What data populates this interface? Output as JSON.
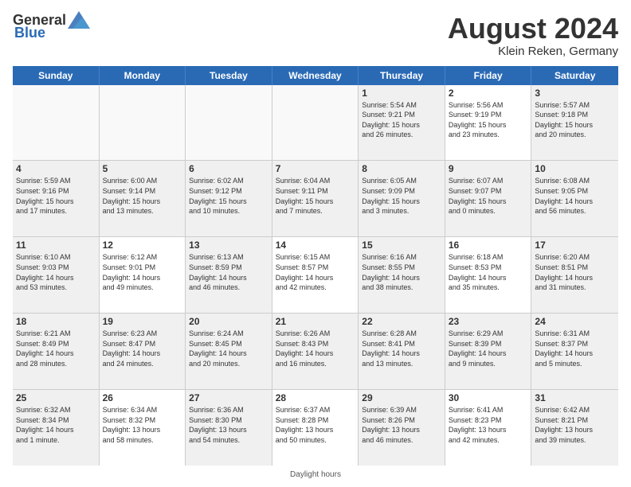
{
  "header": {
    "logo_general": "General",
    "logo_blue": "Blue",
    "month_title": "August 2024",
    "subtitle": "Klein Reken, Germany"
  },
  "days_of_week": [
    "Sunday",
    "Monday",
    "Tuesday",
    "Wednesday",
    "Thursday",
    "Friday",
    "Saturday"
  ],
  "footer_text": "Daylight hours",
  "weeks": [
    [
      {
        "day": "",
        "info": "",
        "shaded": true
      },
      {
        "day": "",
        "info": "",
        "shaded": true
      },
      {
        "day": "",
        "info": "",
        "shaded": true
      },
      {
        "day": "",
        "info": "",
        "shaded": true
      },
      {
        "day": "1",
        "info": "Sunrise: 5:54 AM\nSunset: 9:21 PM\nDaylight: 15 hours\nand 26 minutes.",
        "shaded": false
      },
      {
        "day": "2",
        "info": "Sunrise: 5:56 AM\nSunset: 9:19 PM\nDaylight: 15 hours\nand 23 minutes.",
        "shaded": false
      },
      {
        "day": "3",
        "info": "Sunrise: 5:57 AM\nSunset: 9:18 PM\nDaylight: 15 hours\nand 20 minutes.",
        "shaded": false
      }
    ],
    [
      {
        "day": "4",
        "info": "Sunrise: 5:59 AM\nSunset: 9:16 PM\nDaylight: 15 hours\nand 17 minutes.",
        "shaded": false
      },
      {
        "day": "5",
        "info": "Sunrise: 6:00 AM\nSunset: 9:14 PM\nDaylight: 15 hours\nand 13 minutes.",
        "shaded": false
      },
      {
        "day": "6",
        "info": "Sunrise: 6:02 AM\nSunset: 9:12 PM\nDaylight: 15 hours\nand 10 minutes.",
        "shaded": false
      },
      {
        "day": "7",
        "info": "Sunrise: 6:04 AM\nSunset: 9:11 PM\nDaylight: 15 hours\nand 7 minutes.",
        "shaded": false
      },
      {
        "day": "8",
        "info": "Sunrise: 6:05 AM\nSunset: 9:09 PM\nDaylight: 15 hours\nand 3 minutes.",
        "shaded": false
      },
      {
        "day": "9",
        "info": "Sunrise: 6:07 AM\nSunset: 9:07 PM\nDaylight: 15 hours\nand 0 minutes.",
        "shaded": false
      },
      {
        "day": "10",
        "info": "Sunrise: 6:08 AM\nSunset: 9:05 PM\nDaylight: 14 hours\nand 56 minutes.",
        "shaded": false
      }
    ],
    [
      {
        "day": "11",
        "info": "Sunrise: 6:10 AM\nSunset: 9:03 PM\nDaylight: 14 hours\nand 53 minutes.",
        "shaded": false
      },
      {
        "day": "12",
        "info": "Sunrise: 6:12 AM\nSunset: 9:01 PM\nDaylight: 14 hours\nand 49 minutes.",
        "shaded": false
      },
      {
        "day": "13",
        "info": "Sunrise: 6:13 AM\nSunset: 8:59 PM\nDaylight: 14 hours\nand 46 minutes.",
        "shaded": false
      },
      {
        "day": "14",
        "info": "Sunrise: 6:15 AM\nSunset: 8:57 PM\nDaylight: 14 hours\nand 42 minutes.",
        "shaded": false
      },
      {
        "day": "15",
        "info": "Sunrise: 6:16 AM\nSunset: 8:55 PM\nDaylight: 14 hours\nand 38 minutes.",
        "shaded": false
      },
      {
        "day": "16",
        "info": "Sunrise: 6:18 AM\nSunset: 8:53 PM\nDaylight: 14 hours\nand 35 minutes.",
        "shaded": false
      },
      {
        "day": "17",
        "info": "Sunrise: 6:20 AM\nSunset: 8:51 PM\nDaylight: 14 hours\nand 31 minutes.",
        "shaded": false
      }
    ],
    [
      {
        "day": "18",
        "info": "Sunrise: 6:21 AM\nSunset: 8:49 PM\nDaylight: 14 hours\nand 28 minutes.",
        "shaded": false
      },
      {
        "day": "19",
        "info": "Sunrise: 6:23 AM\nSunset: 8:47 PM\nDaylight: 14 hours\nand 24 minutes.",
        "shaded": false
      },
      {
        "day": "20",
        "info": "Sunrise: 6:24 AM\nSunset: 8:45 PM\nDaylight: 14 hours\nand 20 minutes.",
        "shaded": false
      },
      {
        "day": "21",
        "info": "Sunrise: 6:26 AM\nSunset: 8:43 PM\nDaylight: 14 hours\nand 16 minutes.",
        "shaded": false
      },
      {
        "day": "22",
        "info": "Sunrise: 6:28 AM\nSunset: 8:41 PM\nDaylight: 14 hours\nand 13 minutes.",
        "shaded": false
      },
      {
        "day": "23",
        "info": "Sunrise: 6:29 AM\nSunset: 8:39 PM\nDaylight: 14 hours\nand 9 minutes.",
        "shaded": false
      },
      {
        "day": "24",
        "info": "Sunrise: 6:31 AM\nSunset: 8:37 PM\nDaylight: 14 hours\nand 5 minutes.",
        "shaded": false
      }
    ],
    [
      {
        "day": "25",
        "info": "Sunrise: 6:32 AM\nSunset: 8:34 PM\nDaylight: 14 hours\nand 1 minute.",
        "shaded": false
      },
      {
        "day": "26",
        "info": "Sunrise: 6:34 AM\nSunset: 8:32 PM\nDaylight: 13 hours\nand 58 minutes.",
        "shaded": false
      },
      {
        "day": "27",
        "info": "Sunrise: 6:36 AM\nSunset: 8:30 PM\nDaylight: 13 hours\nand 54 minutes.",
        "shaded": false
      },
      {
        "day": "28",
        "info": "Sunrise: 6:37 AM\nSunset: 8:28 PM\nDaylight: 13 hours\nand 50 minutes.",
        "shaded": false
      },
      {
        "day": "29",
        "info": "Sunrise: 6:39 AM\nSunset: 8:26 PM\nDaylight: 13 hours\nand 46 minutes.",
        "shaded": false
      },
      {
        "day": "30",
        "info": "Sunrise: 6:41 AM\nSunset: 8:23 PM\nDaylight: 13 hours\nand 42 minutes.",
        "shaded": false
      },
      {
        "day": "31",
        "info": "Sunrise: 6:42 AM\nSunset: 8:21 PM\nDaylight: 13 hours\nand 39 minutes.",
        "shaded": false
      }
    ]
  ]
}
